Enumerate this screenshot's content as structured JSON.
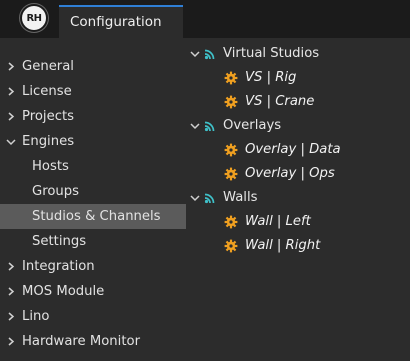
{
  "app": {
    "logo_text": "RH",
    "tab_label": "Configuration",
    "accent": "#2f7fd6"
  },
  "sidebar": {
    "items": [
      {
        "label": "General",
        "level": "top",
        "expandable": true
      },
      {
        "label": "License",
        "level": "top",
        "expandable": true
      },
      {
        "label": "Projects",
        "level": "top",
        "expandable": true
      },
      {
        "label": "Engines",
        "level": "top",
        "expandable": true,
        "expanded": true
      },
      {
        "label": "Hosts",
        "level": "sub"
      },
      {
        "label": "Groups",
        "level": "sub"
      },
      {
        "label": "Studios & Channels",
        "level": "sub",
        "selected": true
      },
      {
        "label": "Settings",
        "level": "sub"
      },
      {
        "label": "Integration",
        "level": "top",
        "expandable": true
      },
      {
        "label": "MOS Module",
        "level": "top",
        "expandable": true
      },
      {
        "label": "Lino",
        "level": "top",
        "expandable": true
      },
      {
        "label": "Hardware Monitor",
        "level": "top",
        "expandable": true
      }
    ]
  },
  "tree": {
    "group_icon": "broadcast-icon",
    "leaf_icon": "gear-icon",
    "icon_colors": {
      "group": "#3fc1c9",
      "leaf": "#f0a020"
    },
    "groups": [
      {
        "label": "Virtual Studios",
        "children": [
          "VS | Rig",
          "VS | Crane"
        ]
      },
      {
        "label": "Overlays",
        "children": [
          "Overlay | Data",
          "Overlay | Ops"
        ]
      },
      {
        "label": "Walls",
        "children": [
          "Wall | Left",
          "Wall | Right"
        ]
      }
    ]
  }
}
